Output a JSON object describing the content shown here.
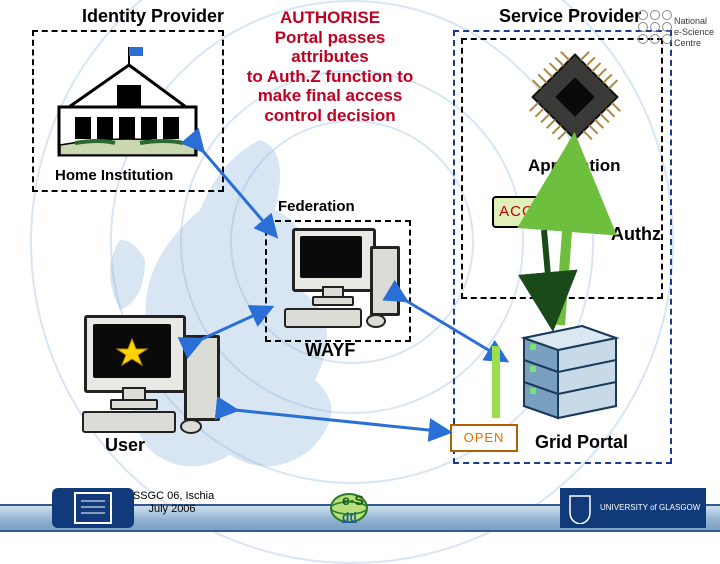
{
  "identity_provider": {
    "label": "Identity Provider"
  },
  "service_provider": {
    "label": "Service Provider"
  },
  "home_institution": {
    "label": "Home Institution"
  },
  "application": {
    "label": "Application"
  },
  "federation": {
    "label": "Federation"
  },
  "wayf": {
    "label": "WAYF"
  },
  "user": {
    "label": "User"
  },
  "grid_portal": {
    "label": "Grid Portal"
  },
  "authz": {
    "label": "Authz"
  },
  "authorise": {
    "line1": "AUTHORISE",
    "line2": "Portal passes",
    "line3": "attributes",
    "line4": "to Auth.Z function to",
    "line5": "make final access",
    "line6": "control decision"
  },
  "accepted": {
    "text": "ACCEPTED"
  },
  "open": {
    "text": "OPEN"
  },
  "nesc": {
    "line1": "National",
    "line2": "e-Science",
    "line3": "Centre"
  },
  "footer": {
    "line1": "ISSGC 06, Ischia",
    "line2": "July 2006",
    "esc_label": "e-S",
    "dti_label": "dti",
    "glasgow_label": "UNIVERSITY of GLASGOW"
  },
  "colors": {
    "accent_red": "#c00020",
    "arrow_green": "#6fbf3f",
    "arrow_blue": "#2a6fd6",
    "footer_rule": "#335a8a"
  }
}
